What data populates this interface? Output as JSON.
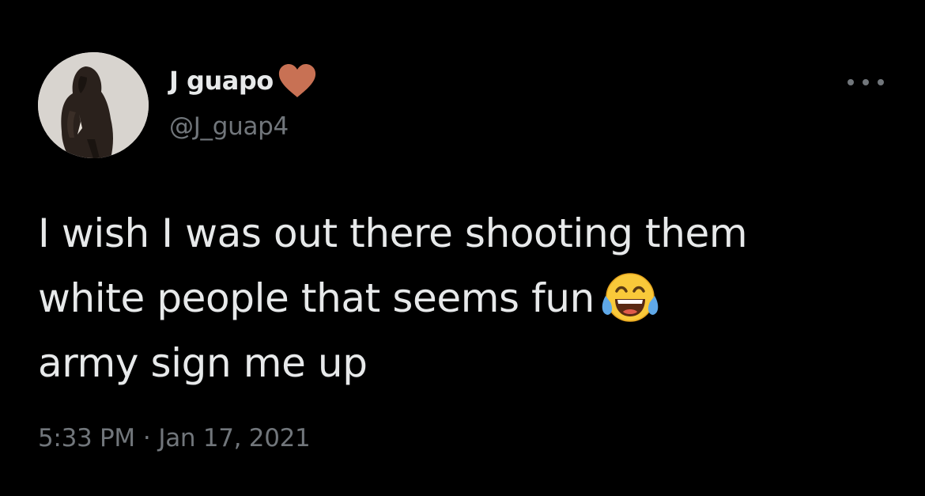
{
  "author": {
    "display_name": "J guapo",
    "handle": "@J_guap4",
    "avatar_icon": "hooded-figure-avatar",
    "name_emoji": "brown-heart-icon"
  },
  "tweet": {
    "lines": [
      "I wish I was out there shooting them",
      "white people that seems fun",
      "army sign me up"
    ],
    "inline_emoji": "face-with-tears-of-joy-icon"
  },
  "meta": {
    "time": "5:33 PM",
    "separator": "·",
    "date": "Jan 17, 2021"
  },
  "menu": {
    "more_icon": "more-options-icon"
  },
  "colors": {
    "background": "#000000",
    "primary_text": "#e7e9ea",
    "secondary_text": "#71767b",
    "heart": "#c87154"
  }
}
